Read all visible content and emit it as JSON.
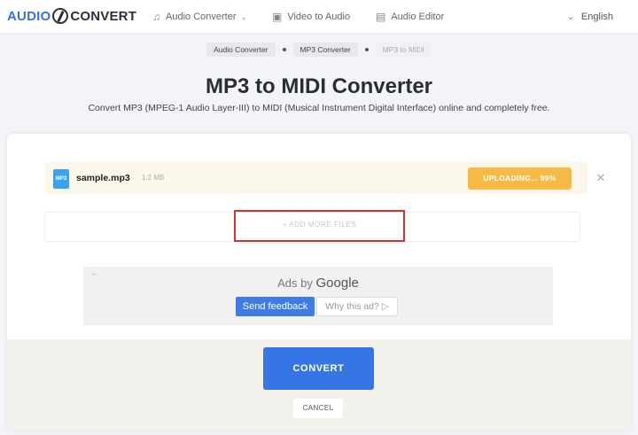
{
  "logo": {
    "part1": "AUDIO",
    "part2": "CONVERT"
  },
  "nav": {
    "audio_converter": "Audio Converter",
    "video_to_audio": "Video to Audio",
    "audio_editor": "Audio Editor",
    "language": "English"
  },
  "breadcrumb": {
    "items": [
      "Audio Converter",
      "MP3 Converter",
      "MP3 to MIDI"
    ]
  },
  "page": {
    "title": "MP3 to MIDI Converter",
    "subtitle": "Convert MP3 (MPEG-1 Audio Layer-III) to MIDI (Musical Instrument Digital Interface) online and completely free."
  },
  "file": {
    "icon_label": "MP3",
    "name": "sample.mp3",
    "size": "1.2 MB",
    "status": "UPLOADING... 99%",
    "progress_percent": 99
  },
  "add_more_label": "+ ADD MORE FILES",
  "ad": {
    "ads_by": "Ads by",
    "google": "Google",
    "send_feedback": "Send feedback",
    "why_this_ad": "Why this ad? ▷"
  },
  "actions": {
    "convert": "CONVERT",
    "cancel": "CANCEL"
  },
  "colors": {
    "accent": "#3675e4",
    "uploading": "#f6ba45",
    "highlight": "#d93030"
  },
  "icons": [
    "note-icon",
    "chevron-down-icon",
    "video-icon",
    "editor-icon",
    "globe-icon",
    "close-icon",
    "back-arrow-icon"
  ]
}
